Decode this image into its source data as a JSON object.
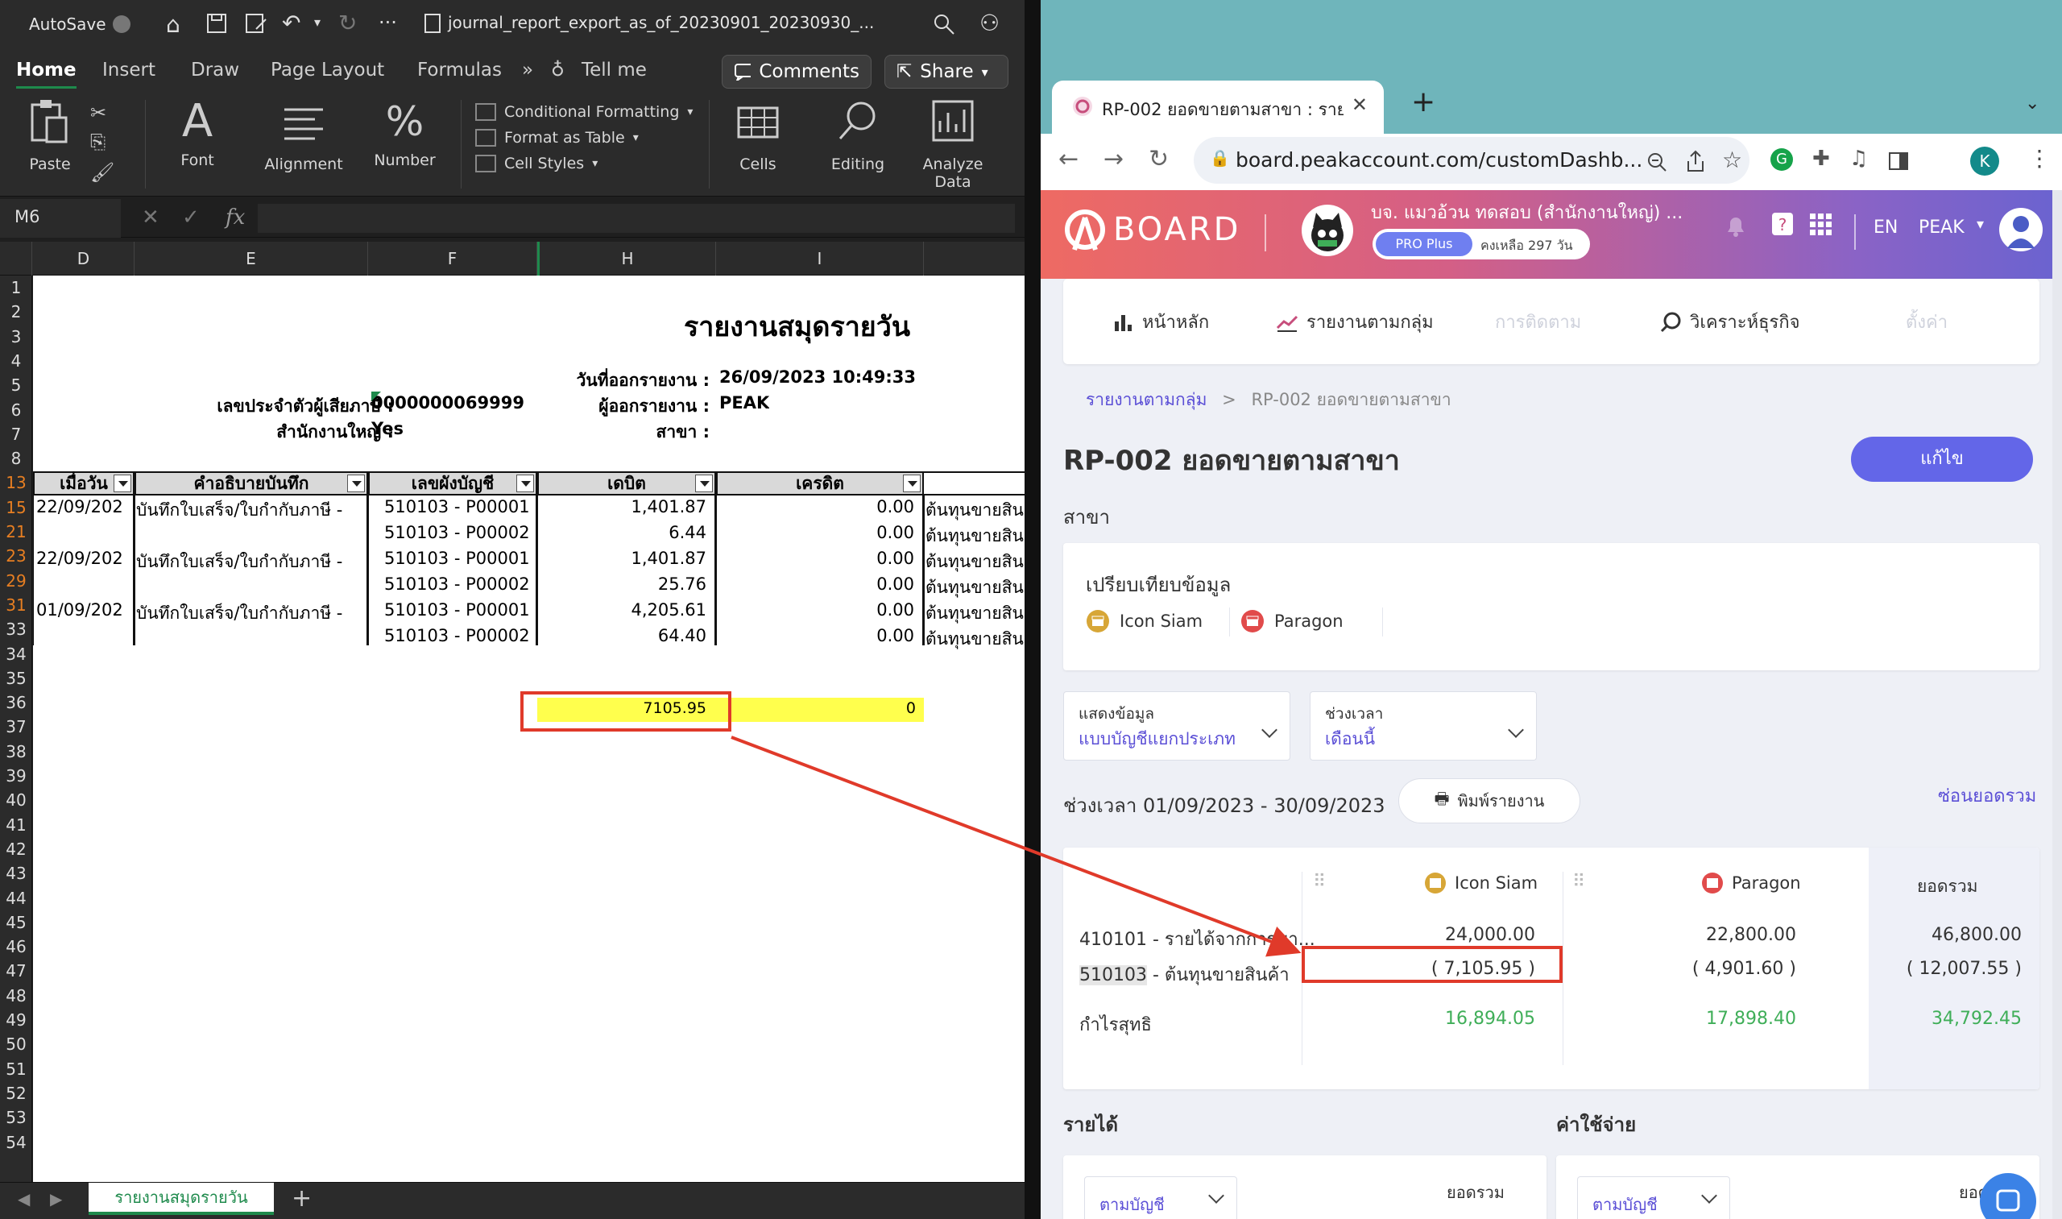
{
  "excel": {
    "autosave": "AutoSave",
    "filename": "journal_report_export_as_of_20230901_20230930_...",
    "tabs": [
      "Home",
      "Insert",
      "Draw",
      "Page Layout",
      "Formulas"
    ],
    "tell_me": "Tell me",
    "comments": "Comments",
    "share": "Share",
    "ribbon": {
      "paste": "Paste",
      "font": "Font",
      "alignment": "Alignment",
      "number": "Number",
      "conditional_formatting": "Conditional Formatting",
      "format_as_table": "Format as Table",
      "cell_styles": "Cell Styles",
      "cells": "Cells",
      "editing": "Editing",
      "analyze_data": "Analyze Data"
    },
    "name_box": "M6",
    "fx": "fx",
    "columns": [
      "D",
      "E",
      "F",
      "H",
      "I"
    ],
    "rows": [
      "1",
      "2",
      "3",
      "4",
      "5",
      "6",
      "7",
      "8",
      "13",
      "15",
      "21",
      "23",
      "29",
      "31",
      "33",
      "34",
      "35",
      "36",
      "37",
      "38",
      "39",
      "40",
      "41",
      "42",
      "43",
      "44",
      "45",
      "46",
      "47",
      "48",
      "49",
      "50",
      "51",
      "52",
      "53",
      "54"
    ],
    "report_title": "รายงานสมุดรายวัน",
    "report_date_label": "วันที่ออกรายงาน :",
    "report_date_value": "26/09/2023 10:49:33",
    "tax_id_label": "เลขประจำตัวผู้เสียภาษี :",
    "tax_id_value": "0000000069999",
    "issuer_label": "ผู้ออกรายงาน :",
    "issuer_value": "PEAK",
    "hq_label": "สำนักงานใหญ่ :",
    "hq_value": "Yes",
    "branch_label": "สาขา :",
    "headers": [
      "เมื่อวัน",
      "คำอธิบายบันทึก",
      "เลขผังบัญชี",
      "เดบิต",
      "เครดิต"
    ],
    "table_rows": [
      {
        "date": "22/09/202",
        "desc": "บันทึกใบเสร็จ/ใบกำกับภาษี - ",
        "acct": "510103 - P00001",
        "debit": "1,401.87",
        "credit": "0.00",
        "extra": "ต้นทุนขายสินค้า"
      },
      {
        "date": "",
        "desc": "",
        "acct": "510103 - P00002",
        "debit": "6.44",
        "credit": "0.00",
        "extra": "ต้นทุนขายสินค้า"
      },
      {
        "date": "22/09/202",
        "desc": "บันทึกใบเสร็จ/ใบกำกับภาษี - ",
        "acct": "510103 - P00001",
        "debit": "1,401.87",
        "credit": "0.00",
        "extra": "ต้นทุนขายสินค้า"
      },
      {
        "date": "",
        "desc": "",
        "acct": "510103 - P00002",
        "debit": "25.76",
        "credit": "0.00",
        "extra": "ต้นทุนขายสินค้า"
      },
      {
        "date": "01/09/202",
        "desc": "บันทึกใบเสร็จ/ใบกำกับภาษี - ",
        "acct": "510103 - P00001",
        "debit": "4,205.61",
        "credit": "0.00",
        "extra": "ต้นทุนขายสินค้า"
      },
      {
        "date": "",
        "desc": "",
        "acct": "510103 - P00002",
        "debit": "64.40",
        "credit": "0.00",
        "extra": "ต้นทุนขายสินค้า"
      }
    ],
    "total_debit": "7105.95",
    "total_credit": "0",
    "sheet_tab": "รายงานสมุดรายวัน"
  },
  "browser": {
    "tab_title": "RP-002 ยอดขายตามสาขา : รายงาน",
    "url": "board.peakaccount.com/customDashb...",
    "profile_initial": "K",
    "company": "บจ. แมวอ้วน ทดสอบ (สำนักงานใหญ่) ...",
    "plan": "PRO Plus",
    "days_left": "คงเหลือ 297 วัน",
    "logo": "BOARD",
    "lang": "EN",
    "peak": "PEAK",
    "nav": [
      "หน้าหลัก",
      "รายงานตามกลุ่ม",
      "การติดตาม",
      "วิเคราะห์ธุรกิจ",
      "ตั้งค่า"
    ],
    "breadcrumb_root": "รายงานตามกลุ่ม",
    "breadcrumb_sep": ">",
    "breadcrumb_current": "RP-002 ยอดขายตามสาขา",
    "page_title": "RP-002 ยอดขายตามสาขา",
    "edit_button": "แก้ไข",
    "branch_section": "สาขา",
    "compare_title": "เปรียบเทียบข้อมูล",
    "branches": [
      "Icon Siam",
      "Paragon"
    ],
    "display_label": "แสดงข้อมูล",
    "display_value": "แบบบัญชีแยกประเภท",
    "period_label": "ช่วงเวลา",
    "period_value": "เดือนนี้",
    "period_range": "ช่วงเวลา 01/09/2023 - 30/09/2023",
    "print_button": "พิมพ์รายงาน",
    "hide_total": "ซ่อนยอดรวม",
    "table": {
      "col_icon_siam": "Icon Siam",
      "col_paragon": "Paragon",
      "col_total": "ยอดรวม",
      "rows": [
        {
          "label": "410101 - รายได้จากการขา...",
          "icon_siam": "24,000.00",
          "paragon": "22,800.00",
          "total": "46,800.00"
        },
        {
          "label_code": "510103",
          "label_rest": " - ต้นทุนขายสินค้า",
          "icon_siam": "( 7,105.95 )",
          "paragon": "( 4,901.60 )",
          "total": "( 12,007.55 )"
        }
      ],
      "net_label": "กำไรสุทธิ",
      "net_icon_siam": "16,894.05",
      "net_paragon": "17,898.40",
      "net_total": "34,792.45"
    },
    "income": "รายได้",
    "expense": "ค่าใช้จ่าย",
    "by_account": "ตามบัญชี",
    "total_short": "ยอดรวม",
    "total_short2": "ยอด"
  }
}
